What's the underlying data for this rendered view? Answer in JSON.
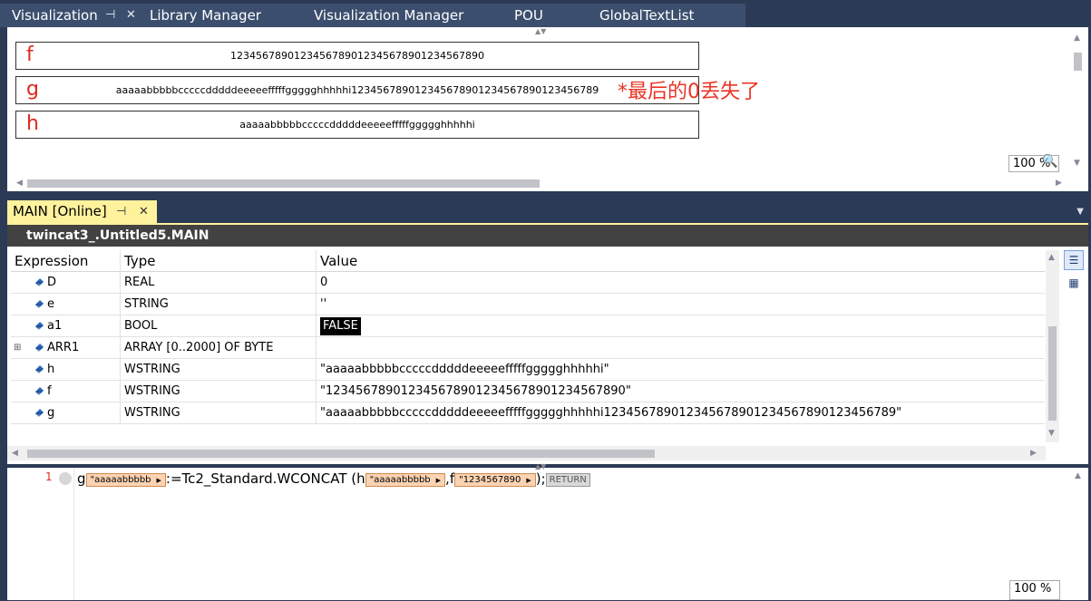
{
  "tabs": [
    {
      "label": "Visualization",
      "active": true
    },
    {
      "label": "Library Manager"
    },
    {
      "label": "Visualization Manager"
    },
    {
      "label": "POU"
    },
    {
      "label": "GlobalTextList"
    }
  ],
  "visualization": {
    "fields": [
      {
        "label": "f",
        "value": "1234567890123456789012345678901234567890"
      },
      {
        "label": "g",
        "value": "aaaaabbbbbcccccdddddeeeeefffffggggghhhhhi123456789012345678901234567890123456789"
      },
      {
        "label": "h",
        "value": "aaaaabbbbbcccccdddddeeeeefffffggggghhhhhi"
      }
    ],
    "annotation": "*最后的0丢失了",
    "zoom": "100 %"
  },
  "main_tab": {
    "label": "MAIN [Online]"
  },
  "watch": {
    "title": "twincat3_.Untitled5.MAIN",
    "columns": {
      "expression": "Expression",
      "type": "Type",
      "value": "Value"
    },
    "rows": [
      {
        "expression": "D",
        "type": "REAL",
        "value": "0"
      },
      {
        "expression": "e",
        "type": "STRING",
        "value": "''"
      },
      {
        "expression": "a1",
        "type": "BOOL",
        "value": "FALSE"
      },
      {
        "expression": "ARR1",
        "type": "ARRAY [0..2000] OF BYTE",
        "value": "",
        "expandable": "⊞"
      },
      {
        "expression": "h",
        "type": "WSTRING",
        "value": "\"aaaaabbbbbcccccdddddeeeeefffffggggghhhhhi\""
      },
      {
        "expression": "f",
        "type": "WSTRING",
        "value": "\"1234567890123456789012345678901234567890\""
      },
      {
        "expression": "g",
        "type": "WSTRING",
        "value": "\"aaaaabbbbbcccccdddddeeeeefffffggggghhhhhi123456789012345678901234567890123456789\""
      }
    ]
  },
  "code": {
    "line_number": "1",
    "tokens": {
      "g": "g",
      "g_inline": "\"aaaaabbbbb",
      "assign_call": ":=Tc2_Standard.WCONCAT (",
      "h": "h",
      "h_inline": "\"aaaaabbbbb",
      "comma": ",",
      "f": "f",
      "f_inline": "\"1234567890",
      "close": ");",
      "return": "RETURN"
    },
    "zoom": "100 %"
  },
  "colors": {
    "frame": "#2b3a55",
    "main_tab": "#fff29d",
    "watch_title": "#424242",
    "field_label": "#e0281c",
    "annotation": "#ea3323",
    "inline_monitor": "#fbd3b3"
  }
}
